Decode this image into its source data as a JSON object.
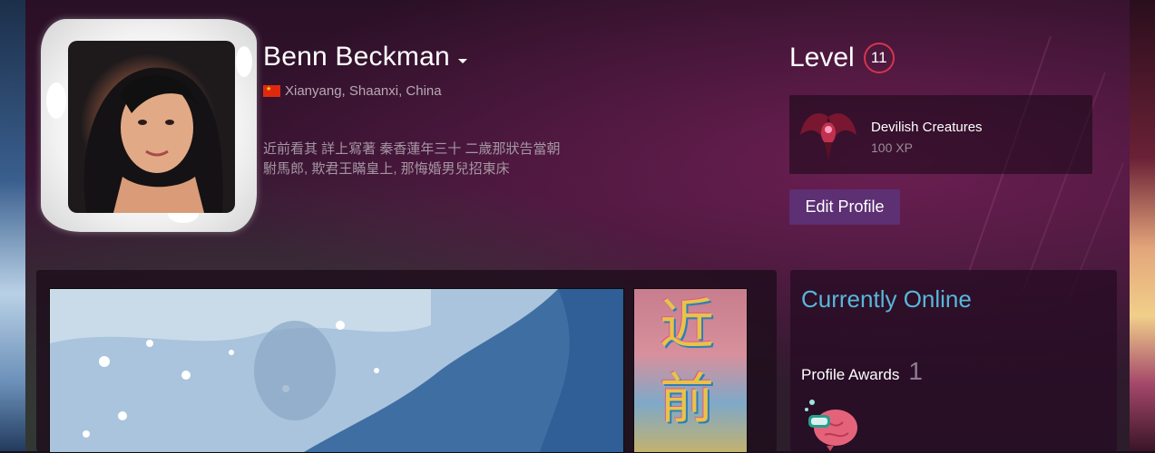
{
  "profile": {
    "persona_name": "Benn Beckman",
    "location": "Xianyang, Shaanxi, China",
    "flag_icon": "china-flag-icon",
    "summary_line1": "近前看其 詳上寫著 秦香蓮年三十 二歲那狀告當朝",
    "summary_line2": "駙馬郎, 欺君王瞞皇上, 那悔婚男兒招東床"
  },
  "level": {
    "label": "Level",
    "value": "11"
  },
  "badge": {
    "name": "Devilish Creatures",
    "xp": "100 XP",
    "icon": "devilish-creatures-badge-icon"
  },
  "actions": {
    "edit_profile": "Edit Profile"
  },
  "status": {
    "online_text": "Currently Online"
  },
  "awards": {
    "label": "Profile Awards",
    "count": "1",
    "icon": "brain-award-icon"
  },
  "showcase": {
    "side_chars": [
      "近",
      "前"
    ]
  },
  "colors": {
    "accent_online": "#57b7d9",
    "level_ring": "#d6344e",
    "edit_button": "#5d2f73"
  }
}
